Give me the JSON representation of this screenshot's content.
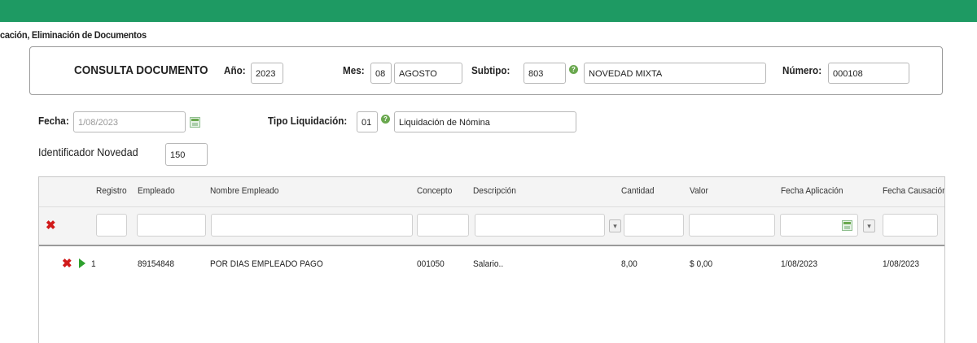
{
  "page_title": "cación, Eliminación de Documentos",
  "header": {
    "title": "CONSULTA DOCUMENTO",
    "anio_label": "Año:",
    "anio": "2023",
    "mes_label": "Mes:",
    "mes_code": "08",
    "mes_name": "AGOSTO",
    "subtipo_label": "Subtipo:",
    "subtipo_code": "803",
    "subtipo_name": "NOVEDAD MIXTA",
    "numero_label": "Número:",
    "numero": "000108"
  },
  "form": {
    "fecha_label": "Fecha:",
    "fecha": "1/08/2023",
    "tipo_liq_label": "Tipo Liquidación:",
    "tipo_liq_code": "01",
    "tipo_liq_name": "Liquidación de Nómina",
    "ident_label": "Identificador Novedad",
    "ident": "150"
  },
  "grid": {
    "columns": [
      "Registro",
      "Empleado",
      "Nombre Empleado",
      "Concepto",
      "Descripción",
      "Cantidad",
      "Valor",
      "Fecha Aplicación",
      "Fecha Causación"
    ],
    "rows": [
      {
        "registro": "1",
        "empleado": "89154848",
        "nombre": "POR DIAS EMPLEADO PAGO",
        "concepto": "001050",
        "descripcion": "Salario..",
        "cantidad": "8,00",
        "valor": "$ 0,00",
        "fecha_aplicacion": "1/08/2023",
        "fecha_causacion": "1/08/2023"
      }
    ]
  },
  "icons": {
    "help": "help-icon",
    "calendar": "calendar-icon",
    "delete": "delete-icon",
    "filter": "filter-icon",
    "expand": "expand-row-icon"
  },
  "colors": {
    "topbar": "#1e9a63",
    "delete": "#d11a1a",
    "expand": "#2ea12e",
    "help": "#6aa84f"
  }
}
